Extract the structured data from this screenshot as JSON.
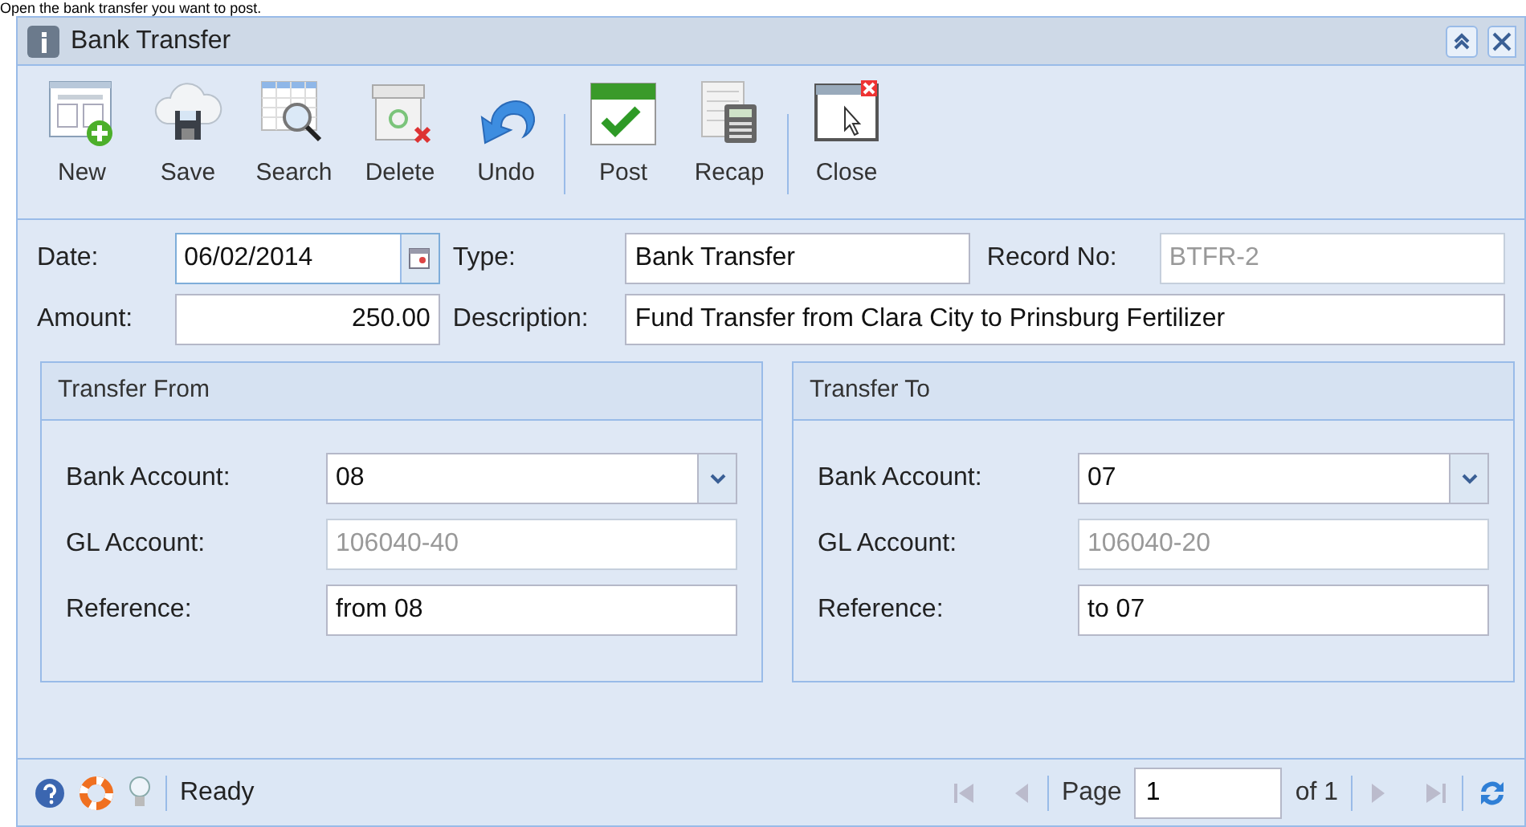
{
  "caption": "Open the bank transfer you want to post.",
  "window": {
    "title": "Bank Transfer"
  },
  "toolbar": [
    {
      "label": "New",
      "kind": "new"
    },
    {
      "label": "Save",
      "kind": "save"
    },
    {
      "label": "Search",
      "kind": "search"
    },
    {
      "label": "Delete",
      "kind": "delete"
    },
    {
      "label": "Undo",
      "kind": "undo"
    },
    {
      "label": "Post",
      "kind": "post"
    },
    {
      "label": "Recap",
      "kind": "recap"
    },
    {
      "label": "Close",
      "kind": "close"
    }
  ],
  "header": {
    "date": {
      "label": "Date:",
      "value": "06/02/2014"
    },
    "type": {
      "label": "Type:",
      "value": "Bank Transfer"
    },
    "record_no": {
      "label": "Record No:",
      "value": "BTFR-2",
      "disabled": true
    },
    "amount": {
      "label": "Amount:",
      "value": "250.00"
    },
    "description": {
      "label": "Description:",
      "value": "Fund Transfer from Clara City to Prinsburg Fertilizer"
    }
  },
  "panels": [
    {
      "title": "Transfer From",
      "fields": [
        {
          "label": "Bank Account:",
          "value": "08",
          "kind": "combo",
          "disabled": false
        },
        {
          "label": "GL Account:",
          "value": "106040-40",
          "kind": "text",
          "disabled": true
        },
        {
          "label": "Reference:",
          "value": "from 08",
          "kind": "text",
          "disabled": false
        }
      ]
    },
    {
      "title": "Transfer To",
      "fields": [
        {
          "label": "Bank Account:",
          "value": "07",
          "kind": "combo",
          "disabled": false
        },
        {
          "label": "GL Account:",
          "value": "106040-20",
          "kind": "text",
          "disabled": true
        },
        {
          "label": "Reference:",
          "value": "to 07",
          "kind": "text",
          "disabled": false
        }
      ]
    }
  ],
  "status_bar": {
    "status": "Ready",
    "page_label": "Page",
    "page": "1",
    "of": "of 1"
  }
}
